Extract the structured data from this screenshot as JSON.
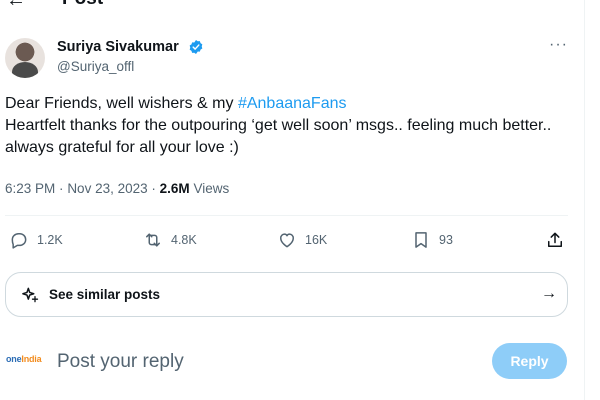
{
  "header": {
    "title": "Post"
  },
  "author": {
    "name": "Suriya Sivakumar",
    "handle": "@Suriya_offl"
  },
  "tweet": {
    "line1_prefix": "Dear Friends, well wishers & my ",
    "hashtag": "#AnbaanaFans",
    "line2": "Heartfelt thanks for the outpouring ‘get well soon’ msgs.. feeling much better.. always grateful for all your love :)"
  },
  "meta": {
    "time": "6:23 PM",
    "date": "Nov 23, 2023",
    "views_count": "2.6M",
    "views_label": "Views",
    "separator": "·"
  },
  "actions": {
    "replies": "1.2K",
    "reposts": "4.8K",
    "likes": "16K",
    "bookmarks": "93"
  },
  "similar": {
    "label": "See similar posts"
  },
  "reply": {
    "placeholder": "Post your reply",
    "button_label": "Reply",
    "logo_text_main": "one",
    "logo_text_accent": "India"
  },
  "colors": {
    "accent": "#1d9bf0",
    "muted": "#536471",
    "text": "#0f1419",
    "reply_button": "#8ecdf8"
  },
  "icons": [
    "back-arrow-icon",
    "verified-icon",
    "more-icon",
    "reply-icon",
    "repost-icon",
    "like-icon",
    "bookmark-icon",
    "share-icon",
    "sparkle-icon",
    "arrow-right-icon"
  ]
}
